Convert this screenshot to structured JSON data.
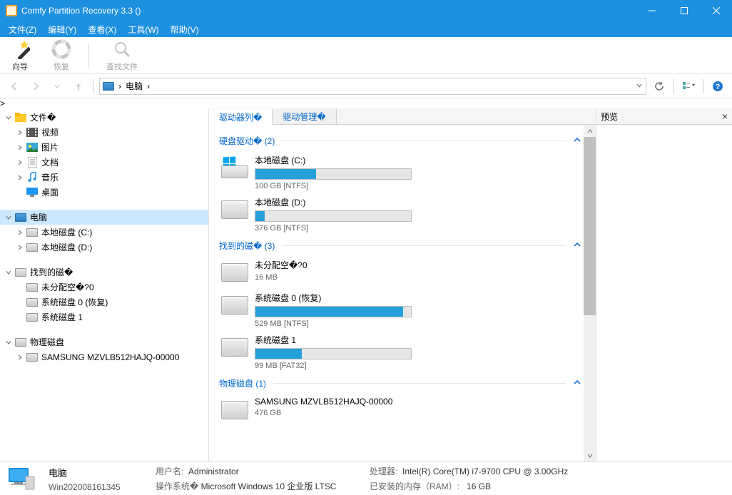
{
  "title": "Comfy Partition Recovery 3.3 ()",
  "menu": [
    "文件(Z)",
    "编辑(Y)",
    "查看(X)",
    "工具(W)",
    "帮助(V)"
  ],
  "toolbar": {
    "wizard": "向导",
    "recover": "恢复",
    "find": "查找文件"
  },
  "address": {
    "sep": "›",
    "label": "电脑"
  },
  "tree": {
    "files_root": "文件�",
    "video": "视频",
    "pictures": "图片",
    "documents": "文档",
    "music": "音乐",
    "desktop": "桌面",
    "computer": "电脑",
    "local_c": "本地磁盘 (C:)",
    "local_d": "本地磁盘 (D:)",
    "found_root": "找到的磁�",
    "unalloc": "未分配空�?0",
    "sys0": "系统磁盘 0 (恢复)",
    "sys1": "系统磁盘 1",
    "physical_root": "物理磁盘",
    "samsung": "SAMSUNG MZVLB512HAJQ-00000"
  },
  "tabs": {
    "drive_list": "驱动器列�",
    "drive_mgmt": "驱动管理�"
  },
  "groups": {
    "hdd": {
      "label": "硬盘驱动�",
      "count": "(2)"
    },
    "found": {
      "label": "找到的磁�",
      "count": "(3)"
    },
    "physical": {
      "label": "物理磁盘",
      "count": "(1)"
    }
  },
  "drives": {
    "c": {
      "name": "本地磁盘 (C:)",
      "sub": "100 GB [NTFS]",
      "pct": 39
    },
    "d": {
      "name": "本地磁盘 (D:)",
      "sub": "376 GB [NTFS]",
      "pct": 6
    },
    "unalloc": {
      "name": "未分配空�?0",
      "sub": "16 MB"
    },
    "sys0": {
      "name": "系统磁盘 0 (恢复)",
      "sub": "529 MB [NTFS]",
      "pct": 95
    },
    "sys1": {
      "name": "系统磁盘 1",
      "sub": "99 MB [FAT32]",
      "pct": 30
    },
    "samsung": {
      "name": "SAMSUNG MZVLB512HAJQ-00000",
      "sub": "476 GB"
    }
  },
  "preview": {
    "title": "预览"
  },
  "status": {
    "title": "电脑",
    "host": "Win202008161345",
    "user_label": "用户名:",
    "user": "Administrator",
    "os_label": "操作系统�",
    "os": "Microsoft Windows 10 企业版 LTSC",
    "cpu_label": "处理器:",
    "cpu": "Intel(R) Core(TM) i7-9700 CPU @ 3.00GHz",
    "ram_label": "已安装的内存（RAM）:",
    "ram": "16 GB"
  }
}
